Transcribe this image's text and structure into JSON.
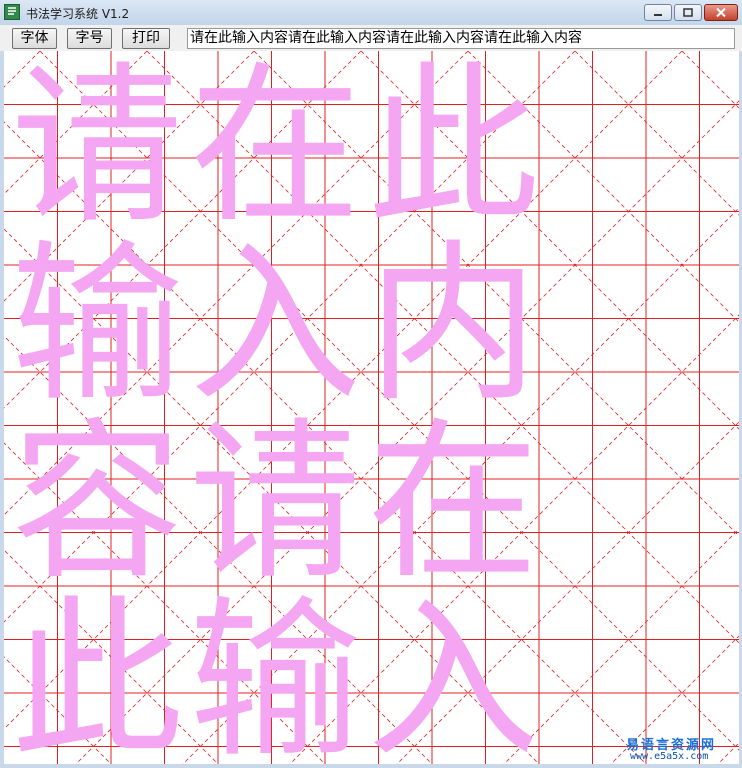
{
  "window": {
    "title": "书法学习系统  V1.2"
  },
  "toolbar": {
    "font_label": "字体",
    "size_label": "字号",
    "print_label": "打印"
  },
  "input": {
    "value": "请在此输入内容请在此输入内容请在此输入内容请在此输入内容"
  },
  "canvas": {
    "characters": [
      "请",
      "在",
      "此",
      "输",
      "入",
      "内",
      "容",
      "请",
      "在",
      "此",
      "输",
      "入"
    ],
    "char_color": "#f4a6f2",
    "grid_color": "#e02020"
  },
  "watermark": {
    "brand": "易语言资源网",
    "url": "www.e5a5x.com"
  },
  "icons": {
    "app": "app-icon",
    "minimize": "minimize-icon",
    "maximize": "maximize-icon",
    "close": "close-icon"
  }
}
